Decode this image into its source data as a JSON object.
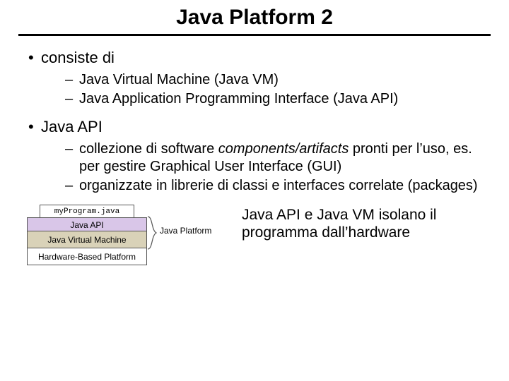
{
  "title": "Java Platform 2",
  "bullets": {
    "b1": "consiste di",
    "b1_subs": {
      "s1": "Java Virtual Machine (Java VM)",
      "s2": "Java Application Programming Interface (Java API)"
    },
    "b2": "Java API",
    "b2_subs": {
      "s1_pre": "collezione di software ",
      "s1_em": "components/artifacts",
      "s1_post": " pronti per l’uso, es. per gestire  Graphical User Interface (GUI)",
      "s2": "organizzate in librerie di classi e interfaces correlate (packages)"
    }
  },
  "diagram": {
    "layers": {
      "program": "myProgram.java",
      "api": "Java API",
      "jvm": "Java Virtual Machine",
      "hw": "Hardware-Based Platform"
    },
    "platform_label": "Java Platform"
  },
  "caption": "Java API e Java VM isolano il programma dall’hardware",
  "colors": {
    "api_bg": "#d9c6e8",
    "jvm_bg": "#d9d2b8"
  }
}
